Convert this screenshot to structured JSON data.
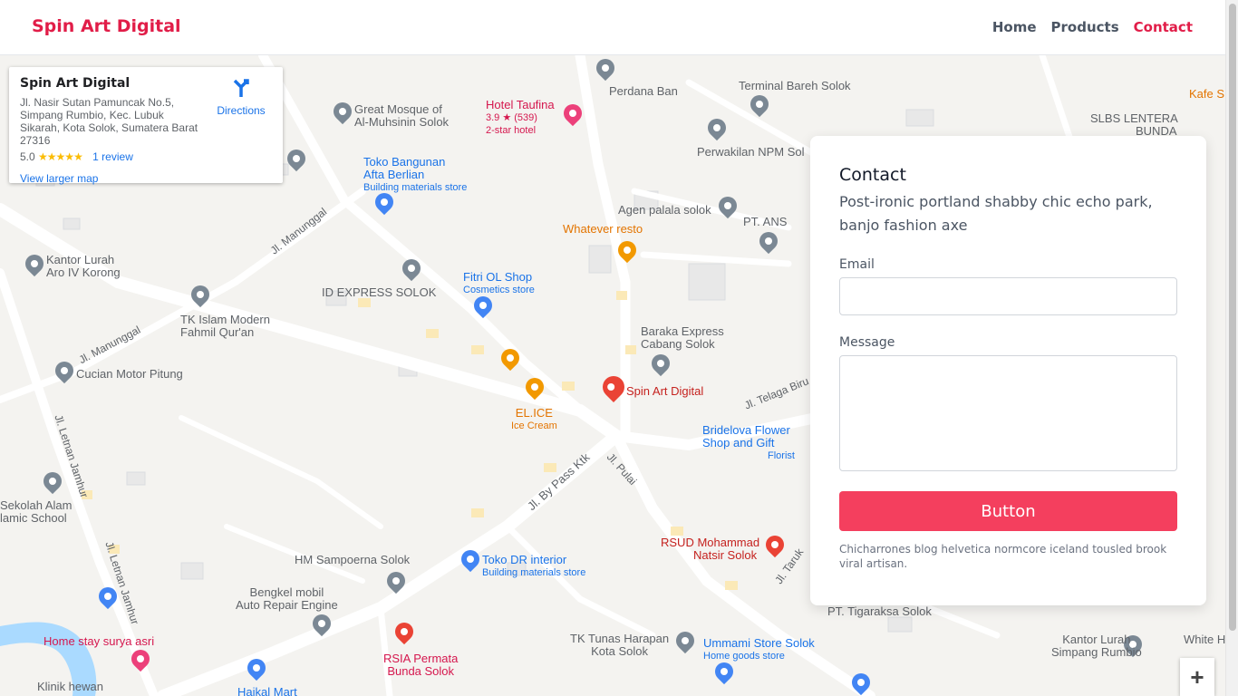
{
  "header": {
    "brand": "Spin Art Digital",
    "nav": [
      "Home",
      "Products",
      "Contact"
    ],
    "active_nav": "Contact"
  },
  "map": {
    "info_card": {
      "title": "Spin Art Digital",
      "address": "Jl. Nasir Sutan Pamuncak No.5, Simpang Rumbio, Kec. Lubuk Sikarah, Kota Solok, Sumatera Barat 27316",
      "rating": "5.0",
      "stars": "★★★★★",
      "reviews": "1 review",
      "directions": "Directions",
      "larger_map": "View larger map"
    },
    "places": {
      "perdana_ban": "Perdana Ban",
      "terminal": "Terminal Bareh Solok",
      "kafe": "Kafe S",
      "hotel_name": "Hotel Taufina",
      "hotel_rating": "3.9 ★ (539)",
      "hotel_class": "2-star hotel",
      "mosque_1": "Great Mosque of",
      "mosque_2": "Al-Muhsinin Solok",
      "slbs_1": "SLBS LENTERA",
      "slbs_2": "BUNDA",
      "npm": "Perwakilan NPM Sol",
      "toko_bangunan_1": "Toko Bangunan",
      "toko_bangunan_2": "Afta Berlian",
      "toko_bangunan_type": "Building materials store",
      "agen": "Agen palala solok",
      "pt_ans": "PT. ANS",
      "whatever": "Whatever resto",
      "kantor_lurah_aro_1": "Kantor Lurah",
      "kantor_lurah_aro_2": "Aro IV Korong",
      "id_express": "ID EXPRESS SOLOK",
      "fitri_1": "Fitri OL Shop",
      "fitri_type": "Cosmetics store",
      "tk_islam_1": "TK Islam Modern",
      "tk_islam_2": "Fahmil Qur'an",
      "baraka_1": "Baraka Express",
      "baraka_2": "Cabang Solok",
      "cucian": "Cucian Motor Pitung",
      "spin_art": "Spin Art Digital",
      "elice": "EL.ICE",
      "elice_type": "Ice Cream",
      "bridelova_1": "Bridelova Flower",
      "bridelova_2": "Shop and Gift",
      "bridelova_type": "Florist",
      "sekolah_1": "Sekolah Alam",
      "sekolah_2": "lamic School",
      "rsud_1": "RSUD Mohammad",
      "rsud_2": "Natsir Solok",
      "hm": "HM Sampoerna Solok",
      "toko_dr": "Toko DR interior",
      "toko_dr_type": "Building materials store",
      "bengkel_1": "Bengkel mobil",
      "bengkel_2": "Auto Repair Engine",
      "tigaraksa": "PT. Tigaraksa Solok",
      "homestay": "Home stay surya asri",
      "rsia_1": "RSIA Permata",
      "rsia_2": "Bunda Solok",
      "tk_tunas_1": "TK Tunas Harapan",
      "tk_tunas_2": "Kota Solok",
      "ummami": "Ummami Store Solok",
      "ummami_type": "Home goods store",
      "kantor_simpang_1": "Kantor Lurah",
      "kantor_simpang_2": "Simpang Rumbio",
      "white": "White H",
      "klinik": "Klinik hewan",
      "haikal": "Haikal Mart"
    },
    "roads": {
      "manunggal_1": "Jl. Manunggal",
      "manunggal_2": "Jl. Manunggal",
      "letnan_1": "Jl. Letnan Jamhur",
      "letnan_2": "Jl. Letnan Jamhur",
      "bypass": "Jl. By Pass Ktk",
      "pulai": "Jl. Pulai",
      "telaga": "Jl. Telaga Biru",
      "taruk": "Jl. Taruk"
    },
    "zoom_in": "+"
  },
  "contact": {
    "title": "Contact",
    "description": "Post-ironic portland shabby chic echo park, banjo fashion axe",
    "email_label": "Email",
    "email_value": "",
    "message_label": "Message",
    "message_value": "",
    "button_label": "Button",
    "note": "Chicharrones blog helvetica normcore iceland tousled brook viral artisan."
  },
  "colors": {
    "accent": "#e11d48",
    "button": "#f43f5e"
  }
}
